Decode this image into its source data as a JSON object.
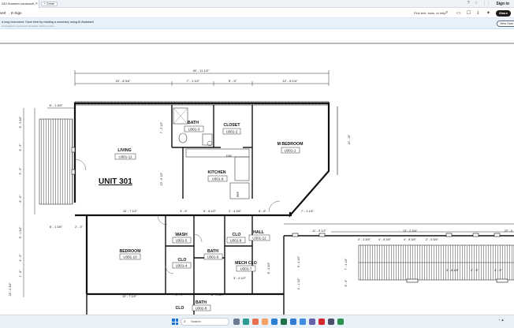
{
  "browser": {
    "tab_title": "240 Summer constructi...",
    "new_tab": "+ Create",
    "signin": "Sign in"
  },
  "toolbar": {
    "left_item_1": "vert",
    "left_item_2": "E-Sign",
    "find_text": "Find text, tools, or help",
    "share": "Share"
  },
  "banner": {
    "text": "a long document. Save time by reading a summary using AI Assistant.",
    "subtext": "AI Assistant is a generative AI feature. Show me more",
    "button": "View Sum"
  },
  "plan": {
    "unit_title": "UNIT 301",
    "dimensions": {
      "overall": "40' - 11 1/2\"",
      "d1": "15' - 8 3/4\"",
      "d2": "7' - 1 1/2\"",
      "d3": "5' - 5\"",
      "d4": "12' - 8 1/4\"",
      "d5": "6' - 1 3/4\"",
      "d6": "6' - 3 3/4\"",
      "d7": "3' - 9\"",
      "d8": "7' - 2 1/2\"",
      "d9": "10' - 6 1/2\"",
      "d10": "10' - 10\"",
      "d11": "12' - 7 1/2\"",
      "d12": "3' - 6\"",
      "d13": "5' - 8 1/2\"",
      "d14": "2' - 4 3/4\"",
      "d15": "6' - 6\"",
      "d16": "7' - 1 1/4\"",
      "d17": "6' - 1 3/4\"",
      "d18": "2' - 3\"",
      "d19": "11' - 5 1/2\"",
      "d20": "13' - 2 3/4\"",
      "d21": "22' - 0",
      "d22": "2' - 3 3/4\"",
      "d23": "4' - 8 3/4\"",
      "d24": "4' - 8 3/4\"",
      "d25": "2' - 0 3/4\"",
      "d26": "3' - 8 1/4\"",
      "d27": "2' - 9\"",
      "d28": "4' - 0\"",
      "d29": "13' - 7 1/4\"",
      "d30": "2' - 7\"",
      "d31": "8' - 9 3/4\"",
      "d32": "3' - 4 1/2\"",
      "d33": "3' - 4 1/2\"",
      "d34": "4' - 3\"",
      "d35": "1' - 6\"",
      "d36": "4' - 1 1/2\"",
      "d37": "7' - 4 1/2\"",
      "d38": "5' - 0\"",
      "d39": "8' - 3 3/4\"",
      "d40": "22' - 2 3/4\"",
      "d41": "3' - 4 1/2\"",
      "d42": "5' - 7 1/2\"",
      "d43": "4' - 11\""
    },
    "rooms": [
      {
        "name": "BATH",
        "tag": "U301-3"
      },
      {
        "name": "CLOSET",
        "tag": "U301-2"
      },
      {
        "name": "LIVING",
        "tag": "U301-11"
      },
      {
        "name": "M BEDROOM",
        "tag": "U301-1"
      },
      {
        "name": "KITCHEN",
        "tag": "U301-9"
      },
      {
        "name": "BEDROOM",
        "tag": "U301-10"
      },
      {
        "name": "WASH",
        "tag": "U301-5"
      },
      {
        "name": "BATH",
        "tag": "U301-6"
      },
      {
        "name": "CLO",
        "tag": "U301-4"
      },
      {
        "name": "CLO",
        "tag": "U301-8"
      },
      {
        "name": "HALL",
        "tag": "U301-12"
      },
      {
        "name": "MECH CLO",
        "tag": "U301-7"
      },
      {
        "name": "BATH",
        "tag": "U302-8"
      },
      {
        "name": "CLO",
        "tag": ""
      }
    ],
    "fixtures": {
      "dw": "DW",
      "ref": "REF"
    }
  },
  "taskbar": {
    "search": "Search"
  }
}
